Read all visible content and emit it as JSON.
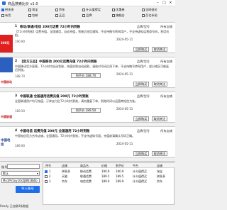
{
  "window": {
    "title": "商品搜索比价 v1.0"
  },
  "filters": [
    {
      "label": "拼多多",
      "checked": true
    },
    {
      "label": "淘宝",
      "checked": false
    },
    {
      "label": "京东",
      "checked": false
    },
    {
      "label": "什么值得买",
      "checked": false
    },
    {
      "label": "优惠券",
      "checked": false
    },
    {
      "label": "全网低价",
      "checked": false
    },
    {
      "label": "有货",
      "checked": false
    },
    {
      "label": "包邮",
      "checked": false
    },
    {
      "label": "正品",
      "checked": false
    },
    {
      "label": "品牌",
      "checked": false
    },
    {
      "label": "旗舰店",
      "checked": false
    },
    {
      "label": "百亿补贴",
      "checked": false
    }
  ],
  "items": [
    {
      "rank": "1",
      "name": "移动/联通/电信 200元话费 72小时内到账",
      "brand": "品牌/型号",
      "shop": "所有店铺",
      "desc": "【72小时到账】话费充值，全国通用，自动充值，到账后短信通知，不支持携号转网用户，不支持虚拟运营商号码，急用勿拍。",
      "price": "190.90",
      "price_button": "到手价 190.90",
      "time": "2024-05-11",
      "buy": "立即购买",
      "off": "取消关注",
      "thumb_text": "200元"
    },
    {
      "rank": "2",
      "name": "【官方正品】中国移动 200元话费充值 72小时内到账",
      "brand": "品牌/型号",
      "shop": "所有店铺",
      "desc": "中国移动官方直营，72小时内自动到账，充值失败自动退款，请核对号码后再下单，不支持携号转网用户，部分地区可能延迟到账。",
      "price": "188.70",
      "price_button": "到手价 188.70",
      "time": "2024-05-11",
      "buy": "立即购买",
      "off": "取消关注",
      "thumb_text": "中国移动"
    },
    {
      "rank": "3",
      "name": "中国联通 全国通用话费充值 200元 72小时到账",
      "brand": "品牌/型号",
      "shop": "所有店铺",
      "desc": "全国联通用户均可充值，订单支付后72小时内到账，请勿重复下单，到账时间以运营商短信为准。",
      "price": "189.50",
      "price_button": "到手价 189.50",
      "time": "2024-05-11",
      "buy": "立即购买",
      "off": "取消关注",
      "thumb_text": "中国联通"
    },
    {
      "rank": "4",
      "name": "中国电信 话费充值 200元 全国通用 72小时到账",
      "brand": "品牌/型号",
      "shop": "所有店铺",
      "desc": "中国电信官方合作店铺，全国通用，72小时内到账，不支持虚拟号段，充值前请确认号码正确。",
      "price": "189.90",
      "price_button": "到手价 189.90",
      "time": "2024-05-11",
      "buy": "立即购买",
      "off": "取消关注",
      "thumb_text": "中国电信"
    }
  ],
  "account": {
    "label": "账号",
    "select_value": "默认",
    "password_mask": "Mx1Pn5xy10s5JBN1Bj6b",
    "import_button": "导入账号"
  },
  "table": {
    "headers": [
      "序号",
      "店铺",
      "商品名",
      "价格",
      "到手价",
      "平台",
      "店铺"
    ],
    "rows": [
      {
        "checked": true,
        "cells": [
          "1",
          "拼多多",
          "移动话费",
          "190.9",
          "190.9",
          "什么值得买",
          "淘宝"
        ]
      },
      {
        "checked": false,
        "cells": [
          "2",
          "天猫",
          "联通话费",
          "189.5",
          "189.5",
          "什么值得买",
          "拼多多"
        ]
      },
      {
        "checked": false,
        "cells": [
          "3",
          "京东",
          "电信话费",
          "189.9",
          "189.9",
          "什么值得买",
          "京东"
        ]
      }
    ]
  },
  "status": "Ready 已加载4条数据"
}
